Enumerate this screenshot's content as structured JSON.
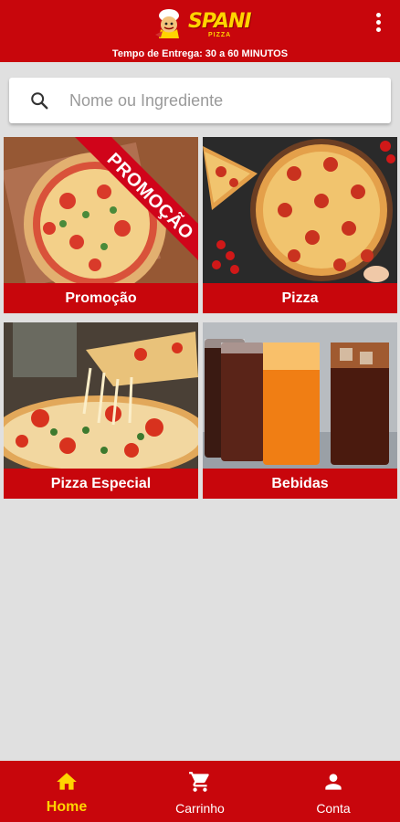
{
  "header": {
    "brand": "SPANI",
    "brand_sub": "PIZZA",
    "delivery_text": "Tempo de Entrega: 30 a 60 MINUTOS",
    "menu_icon": "more-vert-icon"
  },
  "search": {
    "placeholder": "Nome ou Ingrediente",
    "value": "",
    "icon": "search-icon"
  },
  "categories": [
    {
      "label": "Promoção",
      "badge": "PROMOÇÃO"
    },
    {
      "label": "Pizza"
    },
    {
      "label": "Pizza Especial"
    },
    {
      "label": "Bebidas"
    }
  ],
  "bottom_nav": {
    "items": [
      {
        "label": "Home",
        "icon": "home-icon",
        "active": true
      },
      {
        "label": "Carrinho",
        "icon": "cart-icon",
        "active": false
      },
      {
        "label": "Conta",
        "icon": "account-icon",
        "active": false
      }
    ]
  },
  "colors": {
    "brand_red": "#c8060c",
    "brand_yellow": "#ffd400",
    "background": "#e0e0e0"
  }
}
